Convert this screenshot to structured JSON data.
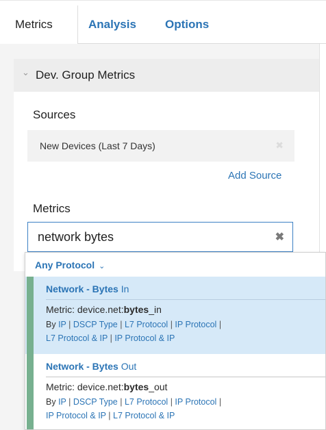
{
  "tabs": {
    "metrics": "Metrics",
    "analysis": "Analysis",
    "options": "Options"
  },
  "group": {
    "title": "Dev. Group Metrics",
    "sources_label": "Sources",
    "source_value": "New Devices (Last 7 Days)",
    "add_source": "Add Source",
    "metrics_label": "Metrics",
    "search_value": "network bytes",
    "clear_icon": "✖",
    "source_remove_icon": "✖"
  },
  "dropdown": {
    "protocol_label": "Any Protocol",
    "results": [
      {
        "title_bold": "Network - Bytes",
        "title_rest": " In",
        "metric_prefix": "Metric: device.net:",
        "metric_bold": "bytes",
        "metric_suffix": "_in",
        "by": "By",
        "links": [
          "IP",
          "DSCP Type",
          "L7 Protocol",
          "IP Protocol",
          "L7 Protocol & IP",
          "IP Protocol & IP"
        ]
      },
      {
        "title_bold": "Network - Bytes",
        "title_rest": " Out",
        "metric_prefix": "Metric: device.net:",
        "metric_bold": "bytes",
        "metric_suffix": "_out",
        "by": "By",
        "links": [
          "IP",
          "DSCP Type",
          "L7 Protocol",
          "IP Protocol",
          "IP Protocol & IP",
          "L7 Protocol & IP"
        ]
      }
    ]
  },
  "colors": {
    "accent": "#2b74b5",
    "selected_row": "#d6e9f8",
    "marker": "#77b08f"
  }
}
